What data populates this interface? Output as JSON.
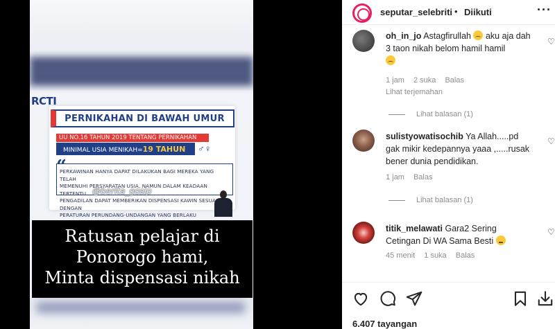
{
  "media": {
    "channel_logo": "RCTI",
    "card_title": "PERNIKAHAN DI BAWAH UMUR",
    "law_line": "UU NO.16 TAHUN 2019 TENTANG PERNIKAHAN",
    "min_age_label": "MINIMAL USIA MENIKAH=",
    "min_age_value": "19 TAHUN",
    "quote_lines": [
      "PERKAWINAN HANYA DAPAT DILAKUKAN BAGI MEREKA YANG TELAH",
      "MEMENUHI PERSYARATAN USIA, NAMUN DALAM KEADAAN TERTENTU",
      "PENGADILAN DAPAT MEMBERIKAN DISPENSASI KAWIN SESUAI DENGAN",
      "PERATURAN PERUNDANG-UNDANGAN YANG BERLAKU"
    ],
    "watermark": "@berita_gosip",
    "caption_lines": [
      "Ratusan pelajar di",
      "Ponorogo hami,",
      "Minta dispensasi nikah"
    ]
  },
  "header": {
    "username": "seputar_selebriti",
    "separator": "•",
    "follow_status": "Diikuti",
    "more": "···"
  },
  "comments": [
    {
      "username": "oh_in_jo",
      "text": "Astagfirullah",
      "text2": "aku aja dah 3 taon nikah belom hamil hamil",
      "time": "1 jam",
      "likes": "2 suka",
      "reply": "Balas",
      "translate": "Lihat terjemahan",
      "replies": "Lihat balasan (1)"
    },
    {
      "username": "sulistyowatisochib",
      "text": "Ya Allah.....pd gak mikir kedepannya yaaa ,.....rusak bener dunia pendidikan.",
      "time": "1 jam",
      "reply": "Balas",
      "replies": "Lihat balasan (1)"
    },
    {
      "username": "titik_melawati",
      "text": "Gara2 Sering Cetingan Di WA Sama Besti",
      "time": "45 menit",
      "likes": "1 suka",
      "reply": "Balas"
    }
  ],
  "footer": {
    "views": "6.407 tayangan"
  },
  "icons": {
    "like": "heart-icon",
    "comment": "comment-icon",
    "share": "share-icon",
    "save": "bookmark-icon",
    "more": "more-icon"
  },
  "colors": {
    "rcti_blue": "#1f3f86",
    "accent_red": "#e53935",
    "accent_yellow": "#f6c445",
    "text": "#262626",
    "muted": "#8e8e8e"
  }
}
